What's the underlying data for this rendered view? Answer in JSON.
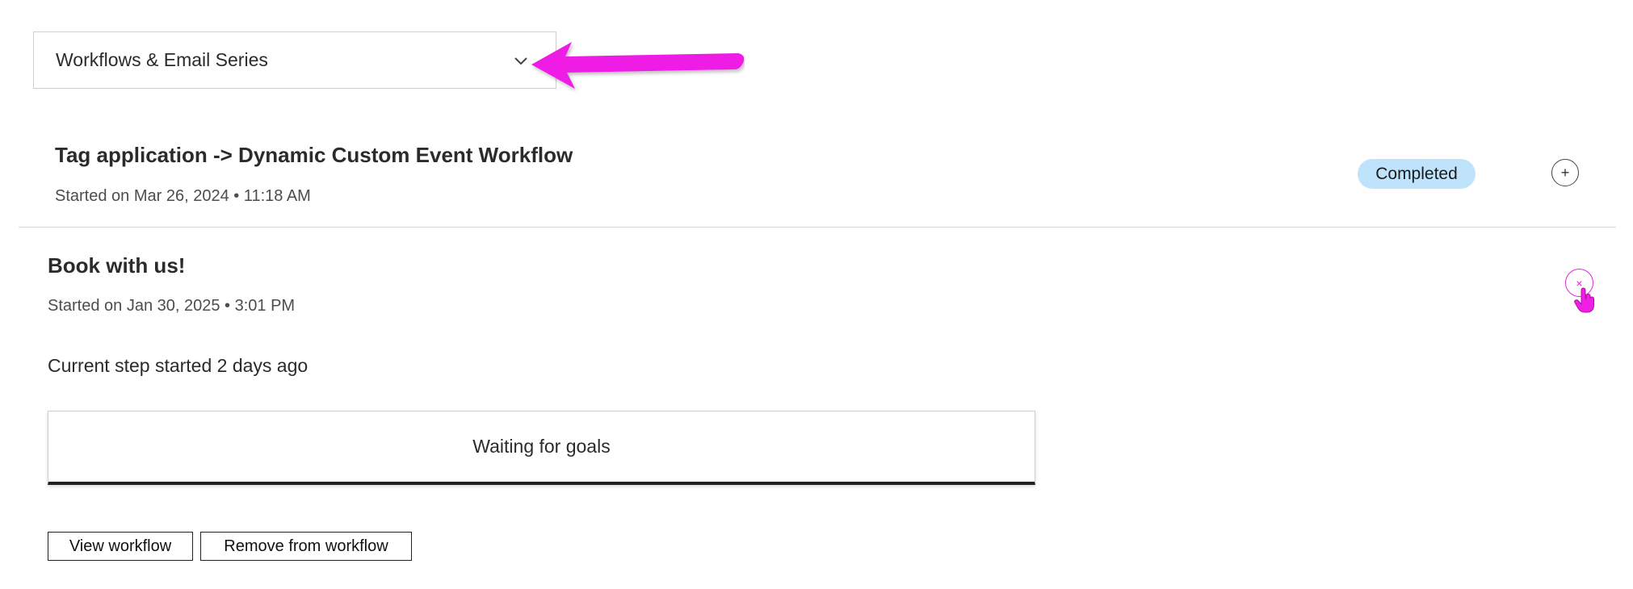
{
  "dropdown": {
    "selected_label": "Workflows & Email Series",
    "chevron_icon": "chevron-down-icon"
  },
  "annotation": {
    "arrow_color": "#ef1fe6"
  },
  "workflows": [
    {
      "title": "Tag application -> Dynamic Custom Event Workflow",
      "started": "Started on Mar 26, 2024 • 11:18 AM",
      "status": "Completed",
      "status_color": "#bfe3fb",
      "toggle_icon": "plus-circle-icon",
      "toggle_glyph": "+"
    },
    {
      "title": "Book with us!",
      "started": "Started on Jan 30, 2025 • 3:01 PM",
      "toggle_icon": "close-circle-icon",
      "toggle_glyph": "×",
      "current_step_text": "Current step started 2 days ago",
      "step_card_text": "Waiting for goals",
      "view_button_label": "View workflow",
      "remove_button_label": "Remove from workflow"
    }
  ],
  "colors": {
    "highlight": "#e524e0",
    "divider": "#d9d9d9"
  }
}
